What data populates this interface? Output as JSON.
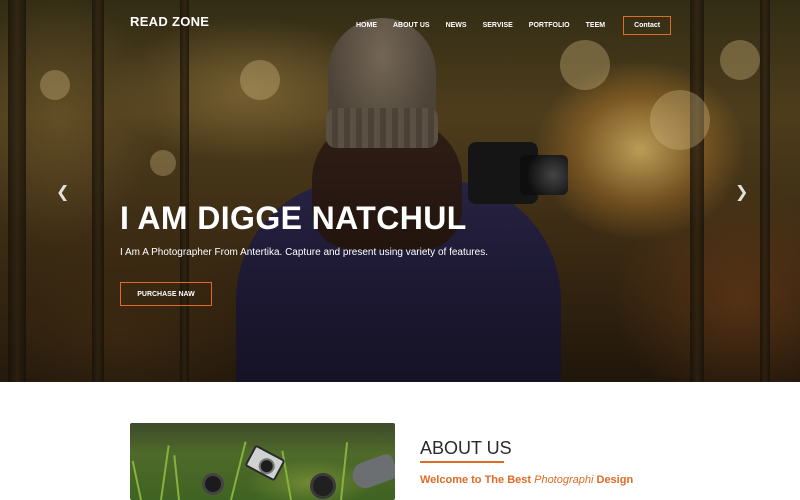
{
  "brand": {
    "logo": "READ ZONE",
    "accent": "#e06b26"
  },
  "nav": {
    "items": [
      "HOME",
      "ABOUT US",
      "NEWS",
      "SERVISE",
      "PORTFOLIO",
      "TEEM"
    ],
    "contact": "Contact"
  },
  "hero": {
    "title": "I AM DIGGE NATCHUL",
    "subtitle": "I Am A Photographer From Antertika. Capture and present using variety of features.",
    "button": "PURCHASE NAW",
    "prev_icon": "chevron-left-icon",
    "next_icon": "chevron-right-icon"
  },
  "about": {
    "heading": "ABOUT US",
    "welcome_prefix": "Welcome to The Best",
    "welcome_italic": "Photographi",
    "welcome_suffix": "Design"
  }
}
